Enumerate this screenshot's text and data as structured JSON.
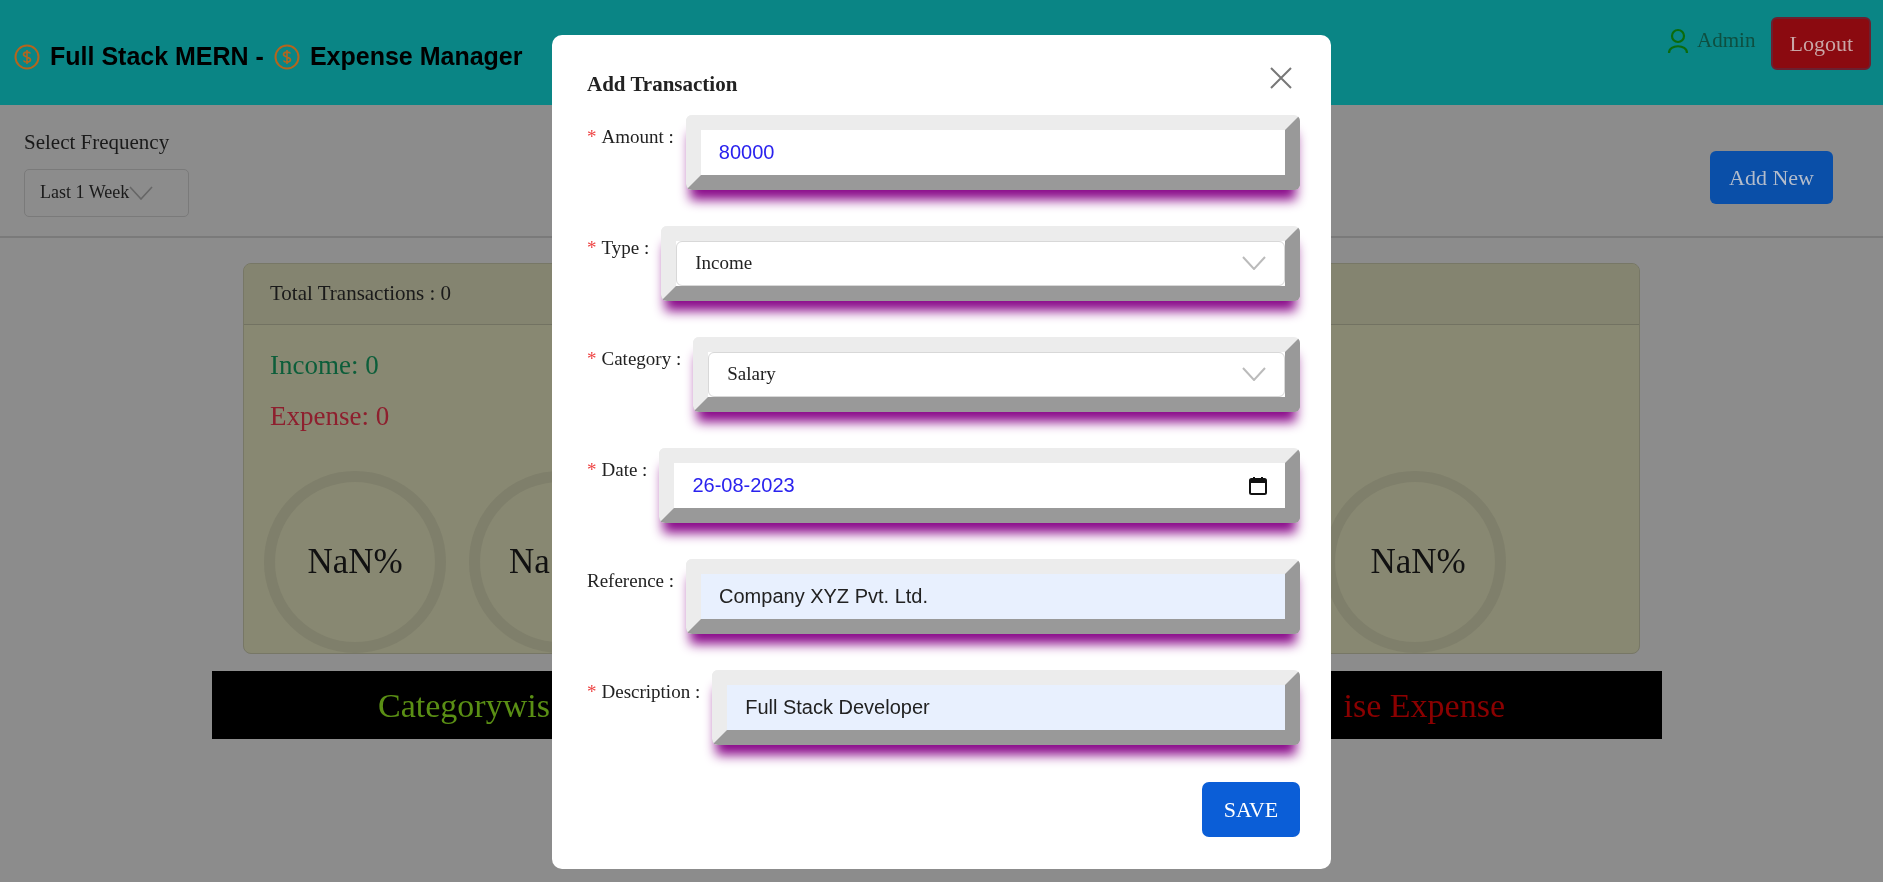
{
  "header": {
    "logo_parts": [
      {
        "text": "Full Stack MERN -"
      },
      {
        "text": "Expense Manager"
      }
    ],
    "user": "Admin",
    "logout": "Logout"
  },
  "filters": {
    "frequency_label": "Select Frequency",
    "frequency_value": "Last 1 Week",
    "add_button": "Add New"
  },
  "summary": {
    "total": "Total Transactions : 0",
    "income": "Income: 0",
    "expense": "Expense: 0",
    "gauges": [
      {
        "text": "NaN%"
      },
      {
        "text": "Na"
      },
      {
        "text": "NaN%"
      }
    ]
  },
  "banner": {
    "income_heading": "Categorywis",
    "expense_heading": "ise Expense"
  },
  "modal": {
    "title": "Add Transaction",
    "fields": [
      {
        "marker": "*",
        "label": "Amount :",
        "kind": "number",
        "value": "80000",
        "autofilled": false
      },
      {
        "marker": "*",
        "label": "Type :",
        "kind": "select",
        "value": "Income",
        "autofilled": false
      },
      {
        "marker": "*",
        "label": "Category :",
        "kind": "select",
        "value": "Salary",
        "autofilled": false
      },
      {
        "marker": "*",
        "label": "Date :",
        "kind": "date",
        "value": "26-08-2023",
        "autofilled": false
      },
      {
        "label": "Reference :",
        "kind": "text",
        "value": "Company XYZ Pvt. Ltd.",
        "autofilled": true
      },
      {
        "marker": "*",
        "label": "Description :",
        "kind": "text",
        "value": "Full Stack Developer",
        "autofilled": true
      }
    ],
    "save": "SAVE"
  }
}
